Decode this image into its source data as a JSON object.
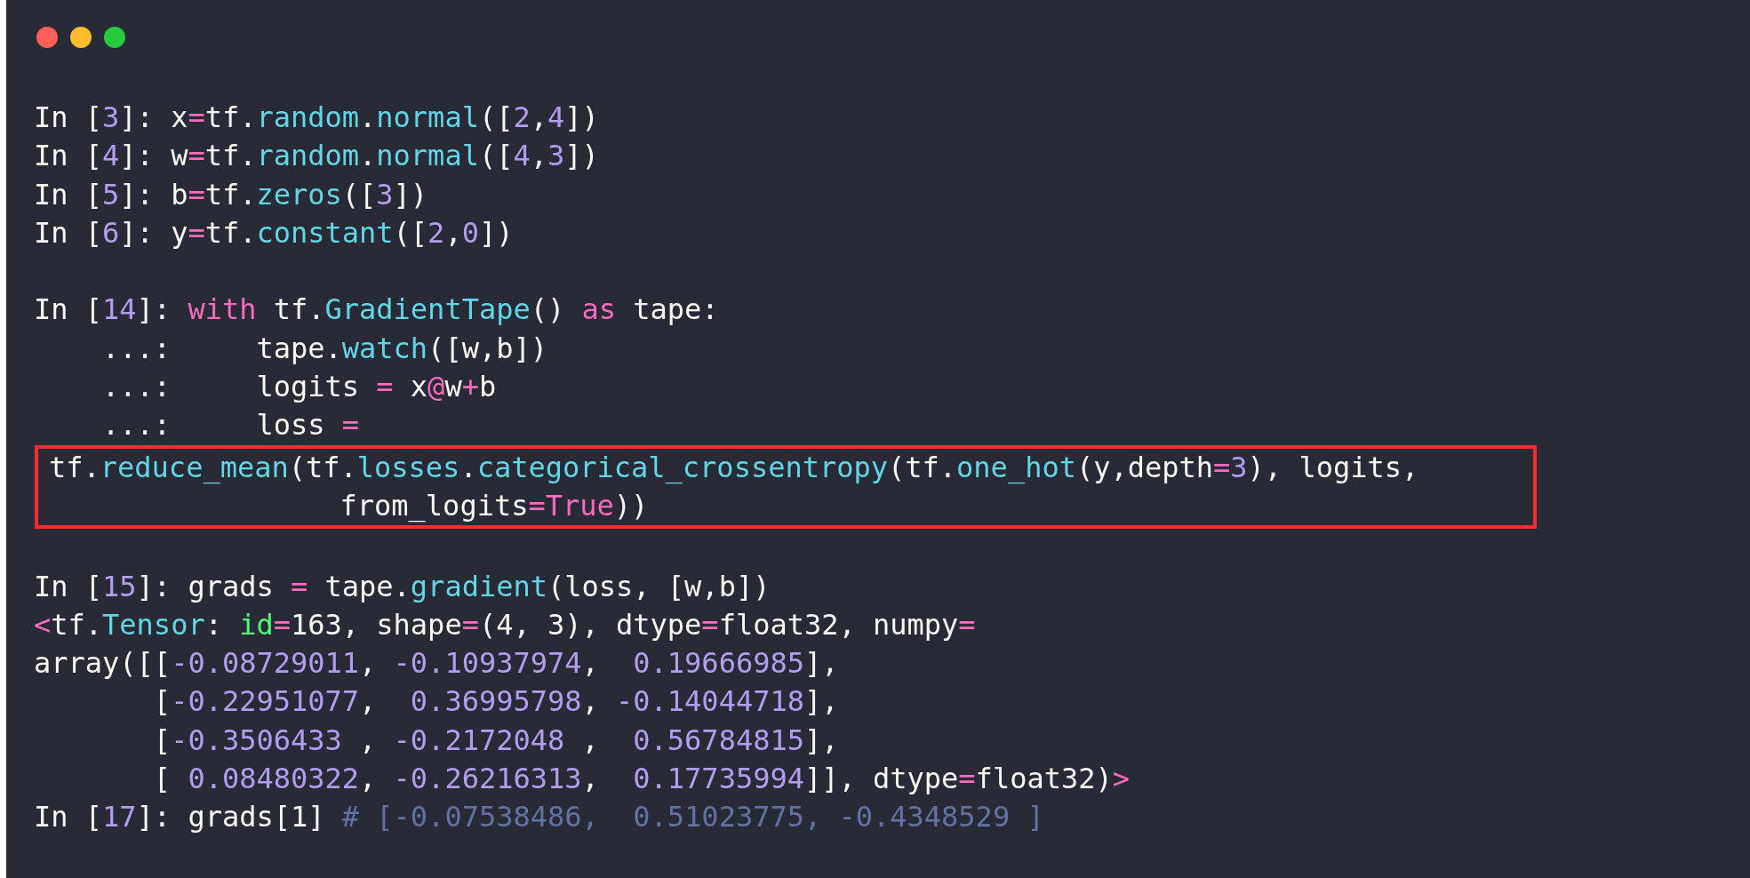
{
  "blocks": [
    {
      "blank_line_before": false,
      "boxed": false,
      "lines": [
        [
          {
            "kind": "t",
            "text": "In ["
          },
          {
            "kind": "n",
            "text": "3"
          },
          {
            "kind": "t",
            "text": "]: x"
          },
          {
            "kind": "k",
            "text": "="
          },
          {
            "kind": "t",
            "text": "tf."
          },
          {
            "kind": "f",
            "text": "random"
          },
          {
            "kind": "t",
            "text": "."
          },
          {
            "kind": "f",
            "text": "normal"
          },
          {
            "kind": "t",
            "text": "(["
          },
          {
            "kind": "n",
            "text": "2"
          },
          {
            "kind": "t",
            "text": ","
          },
          {
            "kind": "n",
            "text": "4"
          },
          {
            "kind": "t",
            "text": "])"
          }
        ],
        [
          {
            "kind": "t",
            "text": "In ["
          },
          {
            "kind": "n",
            "text": "4"
          },
          {
            "kind": "t",
            "text": "]: w"
          },
          {
            "kind": "k",
            "text": "="
          },
          {
            "kind": "t",
            "text": "tf."
          },
          {
            "kind": "f",
            "text": "random"
          },
          {
            "kind": "t",
            "text": "."
          },
          {
            "kind": "f",
            "text": "normal"
          },
          {
            "kind": "t",
            "text": "(["
          },
          {
            "kind": "n",
            "text": "4"
          },
          {
            "kind": "t",
            "text": ","
          },
          {
            "kind": "n",
            "text": "3"
          },
          {
            "kind": "t",
            "text": "])"
          }
        ],
        [
          {
            "kind": "t",
            "text": "In ["
          },
          {
            "kind": "n",
            "text": "5"
          },
          {
            "kind": "t",
            "text": "]: b"
          },
          {
            "kind": "k",
            "text": "="
          },
          {
            "kind": "t",
            "text": "tf."
          },
          {
            "kind": "f",
            "text": "zeros"
          },
          {
            "kind": "t",
            "text": "(["
          },
          {
            "kind": "n",
            "text": "3"
          },
          {
            "kind": "t",
            "text": "])"
          }
        ],
        [
          {
            "kind": "t",
            "text": "In ["
          },
          {
            "kind": "n",
            "text": "6"
          },
          {
            "kind": "t",
            "text": "]: y"
          },
          {
            "kind": "k",
            "text": "="
          },
          {
            "kind": "t",
            "text": "tf."
          },
          {
            "kind": "f",
            "text": "constant"
          },
          {
            "kind": "t",
            "text": "(["
          },
          {
            "kind": "n",
            "text": "2"
          },
          {
            "kind": "t",
            "text": ","
          },
          {
            "kind": "n",
            "text": "0"
          },
          {
            "kind": "t",
            "text": "])"
          }
        ]
      ]
    },
    {
      "blank_line_before": true,
      "boxed": false,
      "lines": [
        [
          {
            "kind": "t",
            "text": "In ["
          },
          {
            "kind": "n",
            "text": "14"
          },
          {
            "kind": "t",
            "text": "]: "
          },
          {
            "kind": "k",
            "text": "with"
          },
          {
            "kind": "t",
            "text": " tf."
          },
          {
            "kind": "f",
            "text": "GradientTape"
          },
          {
            "kind": "t",
            "text": "() "
          },
          {
            "kind": "k",
            "text": "as"
          },
          {
            "kind": "t",
            "text": " tape:"
          }
        ],
        [
          {
            "kind": "t",
            "text": "    ...:     tape."
          },
          {
            "kind": "f",
            "text": "watch"
          },
          {
            "kind": "t",
            "text": "([w,b])"
          }
        ],
        [
          {
            "kind": "t",
            "text": "    ...:     logits "
          },
          {
            "kind": "k",
            "text": "="
          },
          {
            "kind": "t",
            "text": " x"
          },
          {
            "kind": "k",
            "text": "@"
          },
          {
            "kind": "t",
            "text": "w"
          },
          {
            "kind": "k",
            "text": "+"
          },
          {
            "kind": "t",
            "text": "b"
          }
        ],
        [
          {
            "kind": "t",
            "text": "    ...:     loss "
          },
          {
            "kind": "k",
            "text": "="
          }
        ]
      ]
    },
    {
      "blank_line_before": false,
      "boxed": true,
      "lines": [
        [
          {
            "kind": "t",
            "text": "tf."
          },
          {
            "kind": "f",
            "text": "reduce_mean"
          },
          {
            "kind": "t",
            "text": "(tf."
          },
          {
            "kind": "f",
            "text": "losses"
          },
          {
            "kind": "t",
            "text": "."
          },
          {
            "kind": "f",
            "text": "categorical_crossentropy"
          },
          {
            "kind": "t",
            "text": "(tf."
          },
          {
            "kind": "f",
            "text": "one_hot"
          },
          {
            "kind": "t",
            "text": "(y,depth"
          },
          {
            "kind": "k",
            "text": "="
          },
          {
            "kind": "n",
            "text": "3"
          },
          {
            "kind": "t",
            "text": "), logits,"
          }
        ],
        [
          {
            "kind": "t",
            "text": "                 from_logits"
          },
          {
            "kind": "k",
            "text": "="
          },
          {
            "kind": "k",
            "text": "True"
          },
          {
            "kind": "t",
            "text": "))"
          }
        ]
      ]
    },
    {
      "blank_line_before": true,
      "boxed": false,
      "lines": [
        [
          {
            "kind": "t",
            "text": "In ["
          },
          {
            "kind": "n",
            "text": "15"
          },
          {
            "kind": "t",
            "text": "]: grads "
          },
          {
            "kind": "k",
            "text": "="
          },
          {
            "kind": "t",
            "text": " tape."
          },
          {
            "kind": "f",
            "text": "gradient"
          },
          {
            "kind": "t",
            "text": "(loss, [w,b])"
          }
        ],
        [
          {
            "kind": "k",
            "text": "<"
          },
          {
            "kind": "t",
            "text": "tf."
          },
          {
            "kind": "f",
            "text": "Tensor"
          },
          {
            "kind": "t",
            "text": ": "
          },
          {
            "kind": "g",
            "text": "id"
          },
          {
            "kind": "k",
            "text": "="
          },
          {
            "kind": "t",
            "text": "163, shape"
          },
          {
            "kind": "k",
            "text": "="
          },
          {
            "kind": "t",
            "text": "(4, 3), dtype"
          },
          {
            "kind": "k",
            "text": "="
          },
          {
            "kind": "t",
            "text": "float32, numpy"
          },
          {
            "kind": "k",
            "text": "="
          }
        ],
        [
          {
            "kind": "t",
            "text": "array([["
          },
          {
            "kind": "n",
            "text": "-0.08729011"
          },
          {
            "kind": "t",
            "text": ", "
          },
          {
            "kind": "n",
            "text": "-0.10937974"
          },
          {
            "kind": "t",
            "text": ",  "
          },
          {
            "kind": "n",
            "text": "0.19666985"
          },
          {
            "kind": "t",
            "text": "],"
          }
        ],
        [
          {
            "kind": "t",
            "text": "       ["
          },
          {
            "kind": "n",
            "text": "-0.22951077"
          },
          {
            "kind": "t",
            "text": ",  "
          },
          {
            "kind": "n",
            "text": "0.36995798"
          },
          {
            "kind": "t",
            "text": ", "
          },
          {
            "kind": "n",
            "text": "-0.14044718"
          },
          {
            "kind": "t",
            "text": "],"
          }
        ],
        [
          {
            "kind": "t",
            "text": "       ["
          },
          {
            "kind": "n",
            "text": "-0.3506433 "
          },
          {
            "kind": "t",
            "text": ", "
          },
          {
            "kind": "n",
            "text": "-0.2172048 "
          },
          {
            "kind": "t",
            "text": ",  "
          },
          {
            "kind": "n",
            "text": "0.56784815"
          },
          {
            "kind": "t",
            "text": "],"
          }
        ],
        [
          {
            "kind": "t",
            "text": "       [ "
          },
          {
            "kind": "n",
            "text": "0.08480322"
          },
          {
            "kind": "t",
            "text": ", "
          },
          {
            "kind": "n",
            "text": "-0.26216313"
          },
          {
            "kind": "t",
            "text": ",  "
          },
          {
            "kind": "n",
            "text": "0.17735994"
          },
          {
            "kind": "t",
            "text": "]], dtype"
          },
          {
            "kind": "k",
            "text": "="
          },
          {
            "kind": "t",
            "text": "float32)"
          },
          {
            "kind": "k",
            "text": ">"
          }
        ],
        [
          {
            "kind": "t",
            "text": "In ["
          },
          {
            "kind": "n",
            "text": "17"
          },
          {
            "kind": "t",
            "text": "]: grads[1] "
          },
          {
            "kind": "c",
            "text": "# [-0.07538486,  0.51023775, -0.4348529 ]"
          }
        ]
      ]
    }
  ]
}
